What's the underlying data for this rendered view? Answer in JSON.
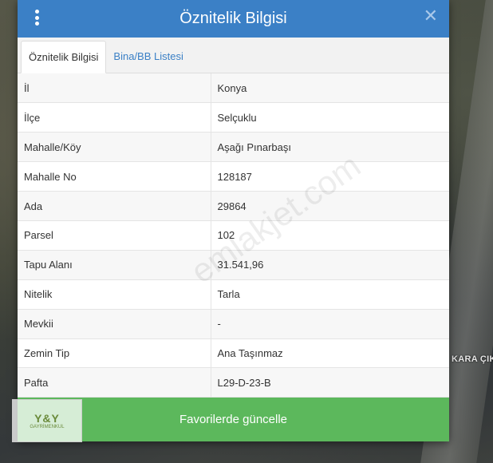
{
  "dialog": {
    "title": "Öznitelik Bilgisi",
    "close": "✕"
  },
  "tabs": [
    {
      "label": "Öznitelik Bilgisi",
      "active": true
    },
    {
      "label": "Bina/BB Listesi",
      "active": false
    }
  ],
  "attributes": [
    {
      "key": "İl",
      "value": "Konya"
    },
    {
      "key": "İlçe",
      "value": "Selçuklu"
    },
    {
      "key": "Mahalle/Köy",
      "value": "Aşağı Pınarbaşı"
    },
    {
      "key": "Mahalle No",
      "value": "128187"
    },
    {
      "key": "Ada",
      "value": "29864"
    },
    {
      "key": "Parsel",
      "value": "102"
    },
    {
      "key": "Tapu Alanı",
      "value": "31.541,96"
    },
    {
      "key": "Nitelik",
      "value": "Tarla"
    },
    {
      "key": "Mevkii",
      "value": "-"
    },
    {
      "key": "Zemin Tip",
      "value": "Ana Taşınmaz"
    },
    {
      "key": "Pafta",
      "value": "L29-D-23-B"
    }
  ],
  "actions": {
    "update_favorites": "Favorilerde güncelle"
  },
  "map": {
    "label": "KARA ÇIKIŞ"
  },
  "watermark": "emlakjet.com",
  "logo": {
    "main": "Y&Y",
    "sub": "GAYRİMENKUL"
  },
  "colors": {
    "header": "#3b80c6",
    "button": "#5cb85c"
  }
}
